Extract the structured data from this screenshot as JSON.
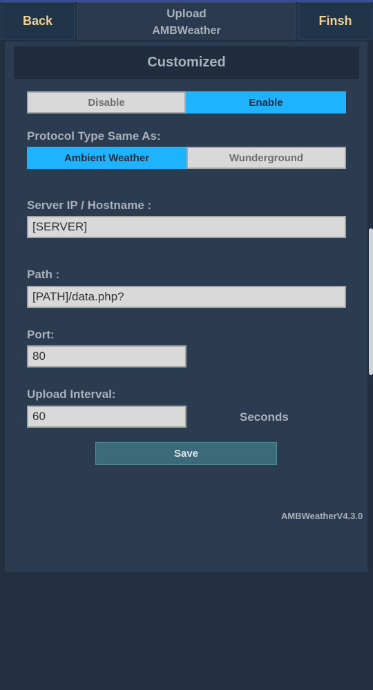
{
  "header": {
    "back_label": "Back",
    "finish_label": "Finsh",
    "title_line1": "Upload",
    "title_line2": "AMBWeather"
  },
  "section": {
    "title": "Customized"
  },
  "toggle": {
    "disable_label": "Disable",
    "enable_label": "Enable",
    "selected": "Enable"
  },
  "protocol": {
    "label": "Protocol Type Same As:",
    "option1": "Ambient Weather",
    "option2": "Wunderground",
    "selected": "Ambient Weather"
  },
  "server": {
    "label": "Server IP / Hostname :",
    "value": "[SERVER]"
  },
  "path": {
    "label": "Path :",
    "value": "[PATH]/data.php?"
  },
  "port": {
    "label": "Port:",
    "value": "80"
  },
  "interval": {
    "label": "Upload Interval:",
    "value": "60",
    "unit": "Seconds"
  },
  "save_label": "Save",
  "version": "AMBWeatherV4.3.0",
  "colors": {
    "accent": "#1eb2ff",
    "header_text": "#f2cf92",
    "background": "#212f40",
    "panel": "#2b3c51"
  }
}
